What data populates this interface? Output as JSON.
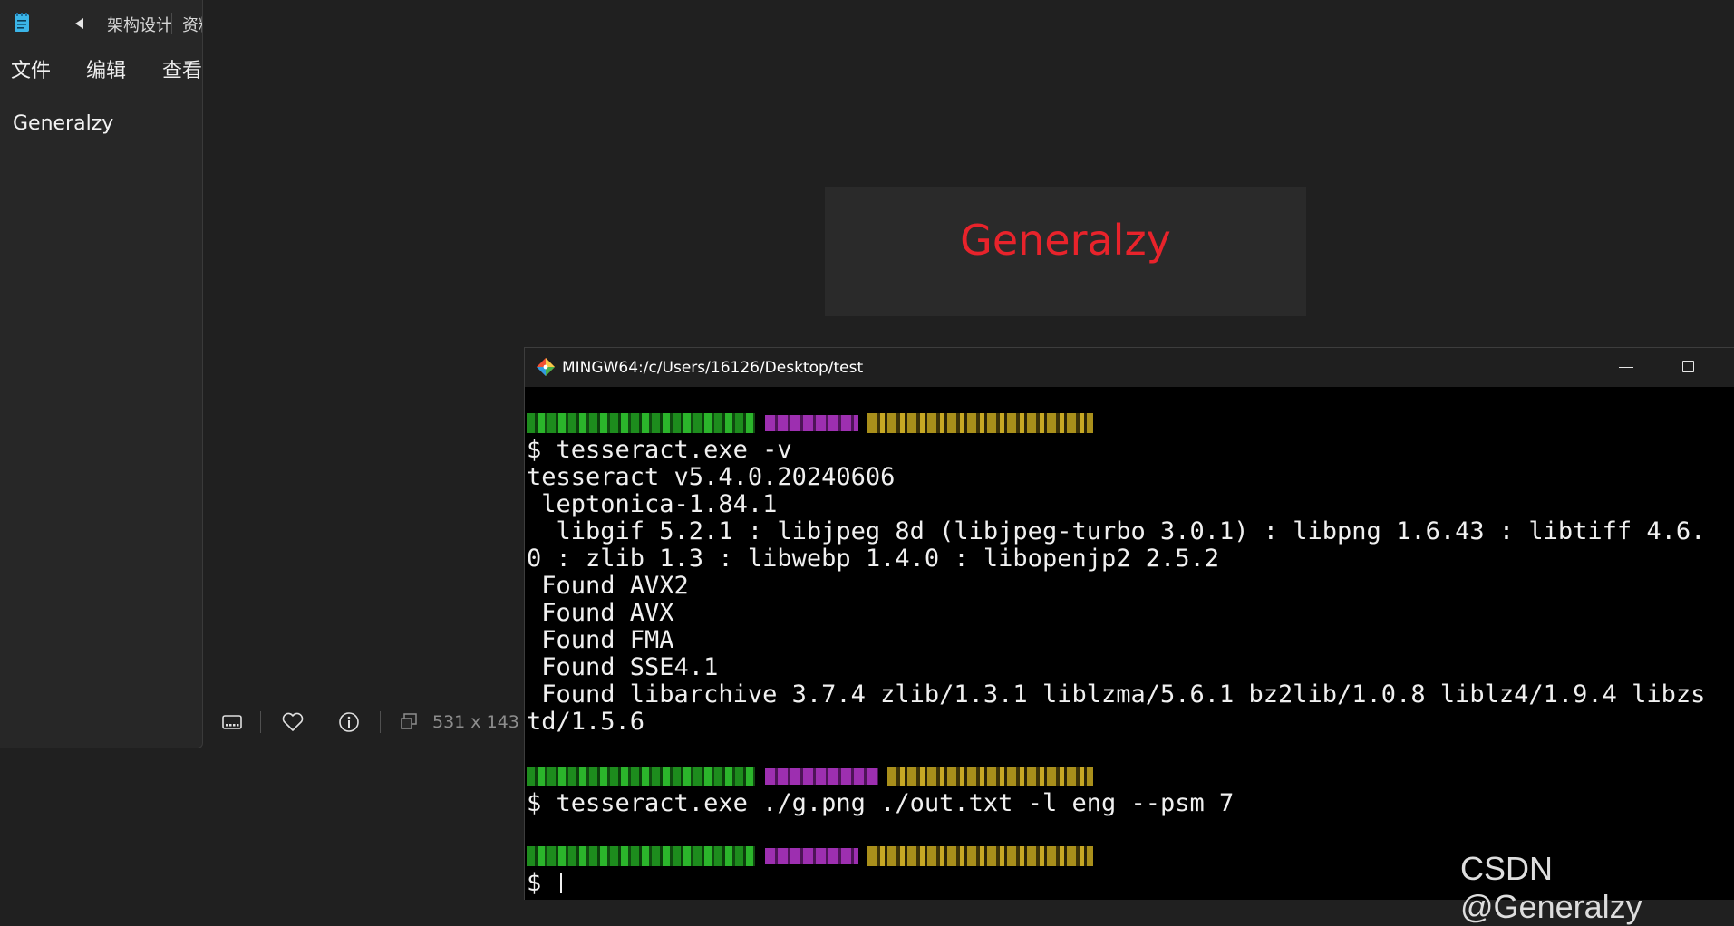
{
  "notepad": {
    "tab_1": "架构设计",
    "tab_2": "资料",
    "menu": [
      "文件",
      "编辑",
      "查看"
    ],
    "content": "Generalzy"
  },
  "viewer_status": {
    "dimensions": "531 x 143"
  },
  "preview": {
    "text": "Generalzy",
    "text_color": "#e8232b"
  },
  "terminal": {
    "title": "MINGW64:/c/Users/16126/Desktop/test",
    "lines": [
      "$ tesseract.exe -v",
      "tesseract v5.4.0.20240606",
      " leptonica-1.84.1",
      "  libgif 5.2.1 : libjpeg 8d (libjpeg-turbo 3.0.1) : libpng 1.6.43 : libtiff 4.6.",
      "0 : zlib 1.3 : libwebp 1.4.0 : libopenjp2 2.5.2",
      " Found AVX2",
      " Found AVX",
      " Found FMA",
      " Found SSE4.1",
      " Found libarchive 3.7.4 zlib/1.3.1 liblzma/5.6.1 bz2lib/1.0.8 liblz4/1.9.4 libzs",
      "td/1.5.6",
      "$ tesseract.exe ./g.png ./out.txt -l eng --psm 7",
      "$ "
    ]
  },
  "watermark": "CSDN @Generalzy",
  "colors": {
    "background": "#202020",
    "terminal_bg": "#000000",
    "prompt_green": "#1fa31f",
    "prompt_magenta": "#a235b5",
    "prompt_yellow": "#b59a1d"
  }
}
